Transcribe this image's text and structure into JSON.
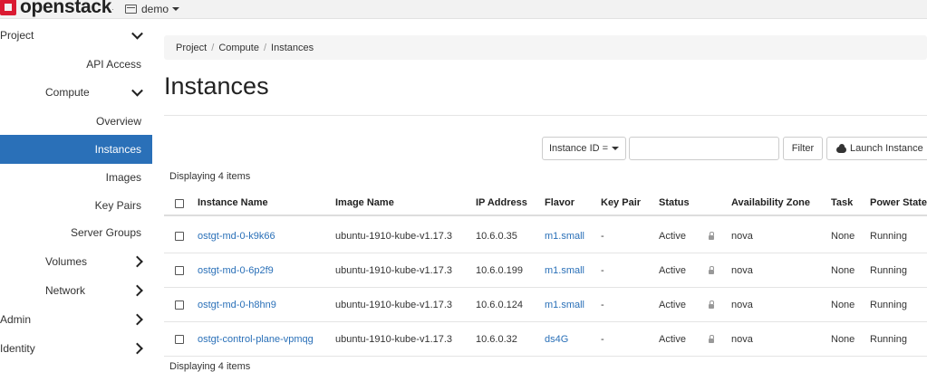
{
  "topbar": {
    "brand": "openstack",
    "brand_suffix": ".",
    "project": "demo"
  },
  "sidebar": {
    "items": [
      {
        "label": "Project"
      },
      {
        "label": "API Access"
      },
      {
        "label": "Compute"
      },
      {
        "label": "Overview"
      },
      {
        "label": "Instances"
      },
      {
        "label": "Images"
      },
      {
        "label": "Key Pairs"
      },
      {
        "label": "Server Groups"
      },
      {
        "label": "Volumes"
      },
      {
        "label": "Network"
      },
      {
        "label": "Admin"
      },
      {
        "label": "Identity"
      }
    ]
  },
  "breadcrumb": [
    "Project",
    "Compute",
    "Instances"
  ],
  "page_title": "Instances",
  "filter": {
    "select_label": "Instance ID =",
    "input_value": "",
    "filter_button": "Filter",
    "launch_button": "Launch Instance"
  },
  "count_top": "Displaying 4 items",
  "count_bottom": "Displaying 4 items",
  "table": {
    "columns": [
      "Instance Name",
      "Image Name",
      "IP Address",
      "Flavor",
      "Key Pair",
      "Status",
      "Availability Zone",
      "Task",
      "Power State"
    ],
    "rows": [
      {
        "name": "ostgt-md-0-k9k66",
        "image": "ubuntu-1910-kube-v1.17.3",
        "ip": "10.6.0.35",
        "flavor": "m1.small",
        "keypair": "-",
        "status": "Active",
        "zone": "nova",
        "task": "None",
        "power": "Running"
      },
      {
        "name": "ostgt-md-0-6p2f9",
        "image": "ubuntu-1910-kube-v1.17.3",
        "ip": "10.6.0.199",
        "flavor": "m1.small",
        "keypair": "-",
        "status": "Active",
        "zone": "nova",
        "task": "None",
        "power": "Running"
      },
      {
        "name": "ostgt-md-0-h8hn9",
        "image": "ubuntu-1910-kube-v1.17.3",
        "ip": "10.6.0.124",
        "flavor": "m1.small",
        "keypair": "-",
        "status": "Active",
        "zone": "nova",
        "task": "None",
        "power": "Running"
      },
      {
        "name": "ostgt-control-plane-vpmqg",
        "image": "ubuntu-1910-kube-v1.17.3",
        "ip": "10.6.0.32",
        "flavor": "ds4G",
        "keypair": "-",
        "status": "Active",
        "zone": "nova",
        "task": "None",
        "power": "Running"
      }
    ]
  },
  "colors": {
    "accent": "#2a70b8",
    "brand_red": "#da1a32"
  }
}
